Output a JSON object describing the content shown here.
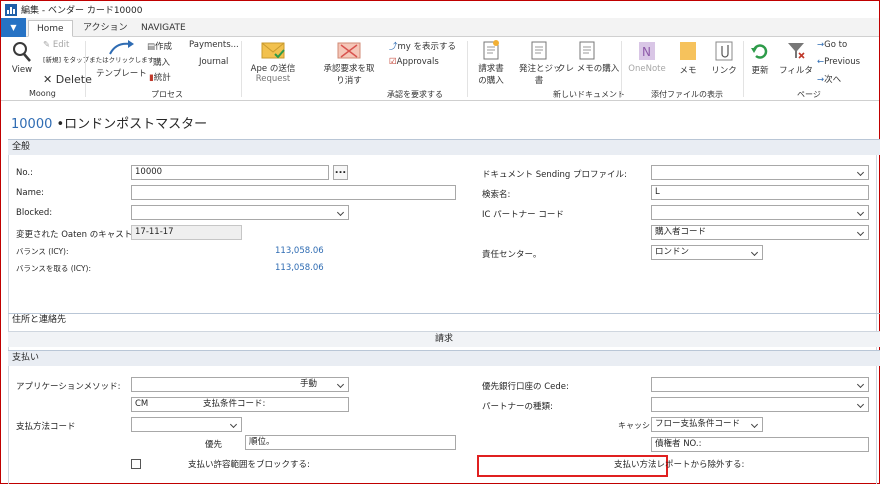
{
  "window": {
    "title": "編集 - ベンダー カード10000"
  },
  "tabs": [
    "Home",
    "アクション",
    "NAVIGATE"
  ],
  "ribbon": {
    "view": "View",
    "edit": "Edit",
    "new": "[新規] をタップまたはクリックします",
    "delete": "Delete",
    "template": "テンプレート",
    "create": "作成",
    "purchase": "購入",
    "statistics": "統計",
    "payments": "Payments...",
    "journal": "Journal",
    "approval_send": "Ape の送信",
    "approval_send_2": "Request",
    "approval_cancel": "承認要求を取",
    "approval_cancel_2": "り消す",
    "show_approval": "my を表示する",
    "approvals": "Approvals",
    "invoice": "請求書",
    "invoice_2": "の購入",
    "order": "発注とジッ",
    "order_2": "書",
    "credit_memo": "クレ メモの購入",
    "onenote": "OneNote",
    "memo": "メモ",
    "link": "リンク",
    "refresh": "更新",
    "filter": "フィルタ",
    "goto": "Go to",
    "previous": "Previous",
    "next": "次へ",
    "groups": {
      "moong": "Moong",
      "process": "プロセス",
      "request_approval": "承認を要求する",
      "new_document": "新しいドキュメント",
      "attachments": "添付ファイルの表示",
      "page": "ページ"
    }
  },
  "page_title": {
    "number": "10000",
    "name": "•ロンドンポストマスター"
  },
  "general": {
    "header": "全般",
    "no_label": "No.:",
    "no_value": "10000",
    "no_btn": "...",
    "name_label": "Name:",
    "blocked_label": "Blocked:",
    "changed_label": "変更された Oaten のキャスト:",
    "changed_value": "17-11-17",
    "balance_label": "バランス (ICY):",
    "balance_value": "113,058.06",
    "balance_due_label": "バランスを取る (ICY):",
    "balance_due_value": "113,058.06",
    "doc_sending_label": "ドキュメント Sending プロファイル:",
    "search_name_label": "検索名:",
    "search_name_value": "L",
    "ic_partner_label": "IC パートナー コード",
    "purchaser_value": "購入者コード",
    "responsibility_label": "責任センター。",
    "responsibility_value": "ロンドン"
  },
  "address": {
    "header": "住所と連絡先",
    "invoicing": "請求"
  },
  "payments": {
    "header": "支払い",
    "app_method_label": "アプリケーションメソッド:",
    "app_method_value": "手動",
    "terms_value": "CM",
    "terms_label": "支払条件コード:",
    "method_label": "支払方法コード",
    "priority_prefix": "優先",
    "priority_label": "順位。",
    "block_label": "支払い許容範囲をブロックする:",
    "pref_bank_label": "優先銀行口座の Cede:",
    "partner_type_label": "パートナーの種類:",
    "cashflow_prefix": "キャッシュ",
    "cashflow_value": "フロー支払条件コード",
    "creditor_value": "債権者 NO.:",
    "exclude_label": "支払い方法レポートから除外する:"
  }
}
